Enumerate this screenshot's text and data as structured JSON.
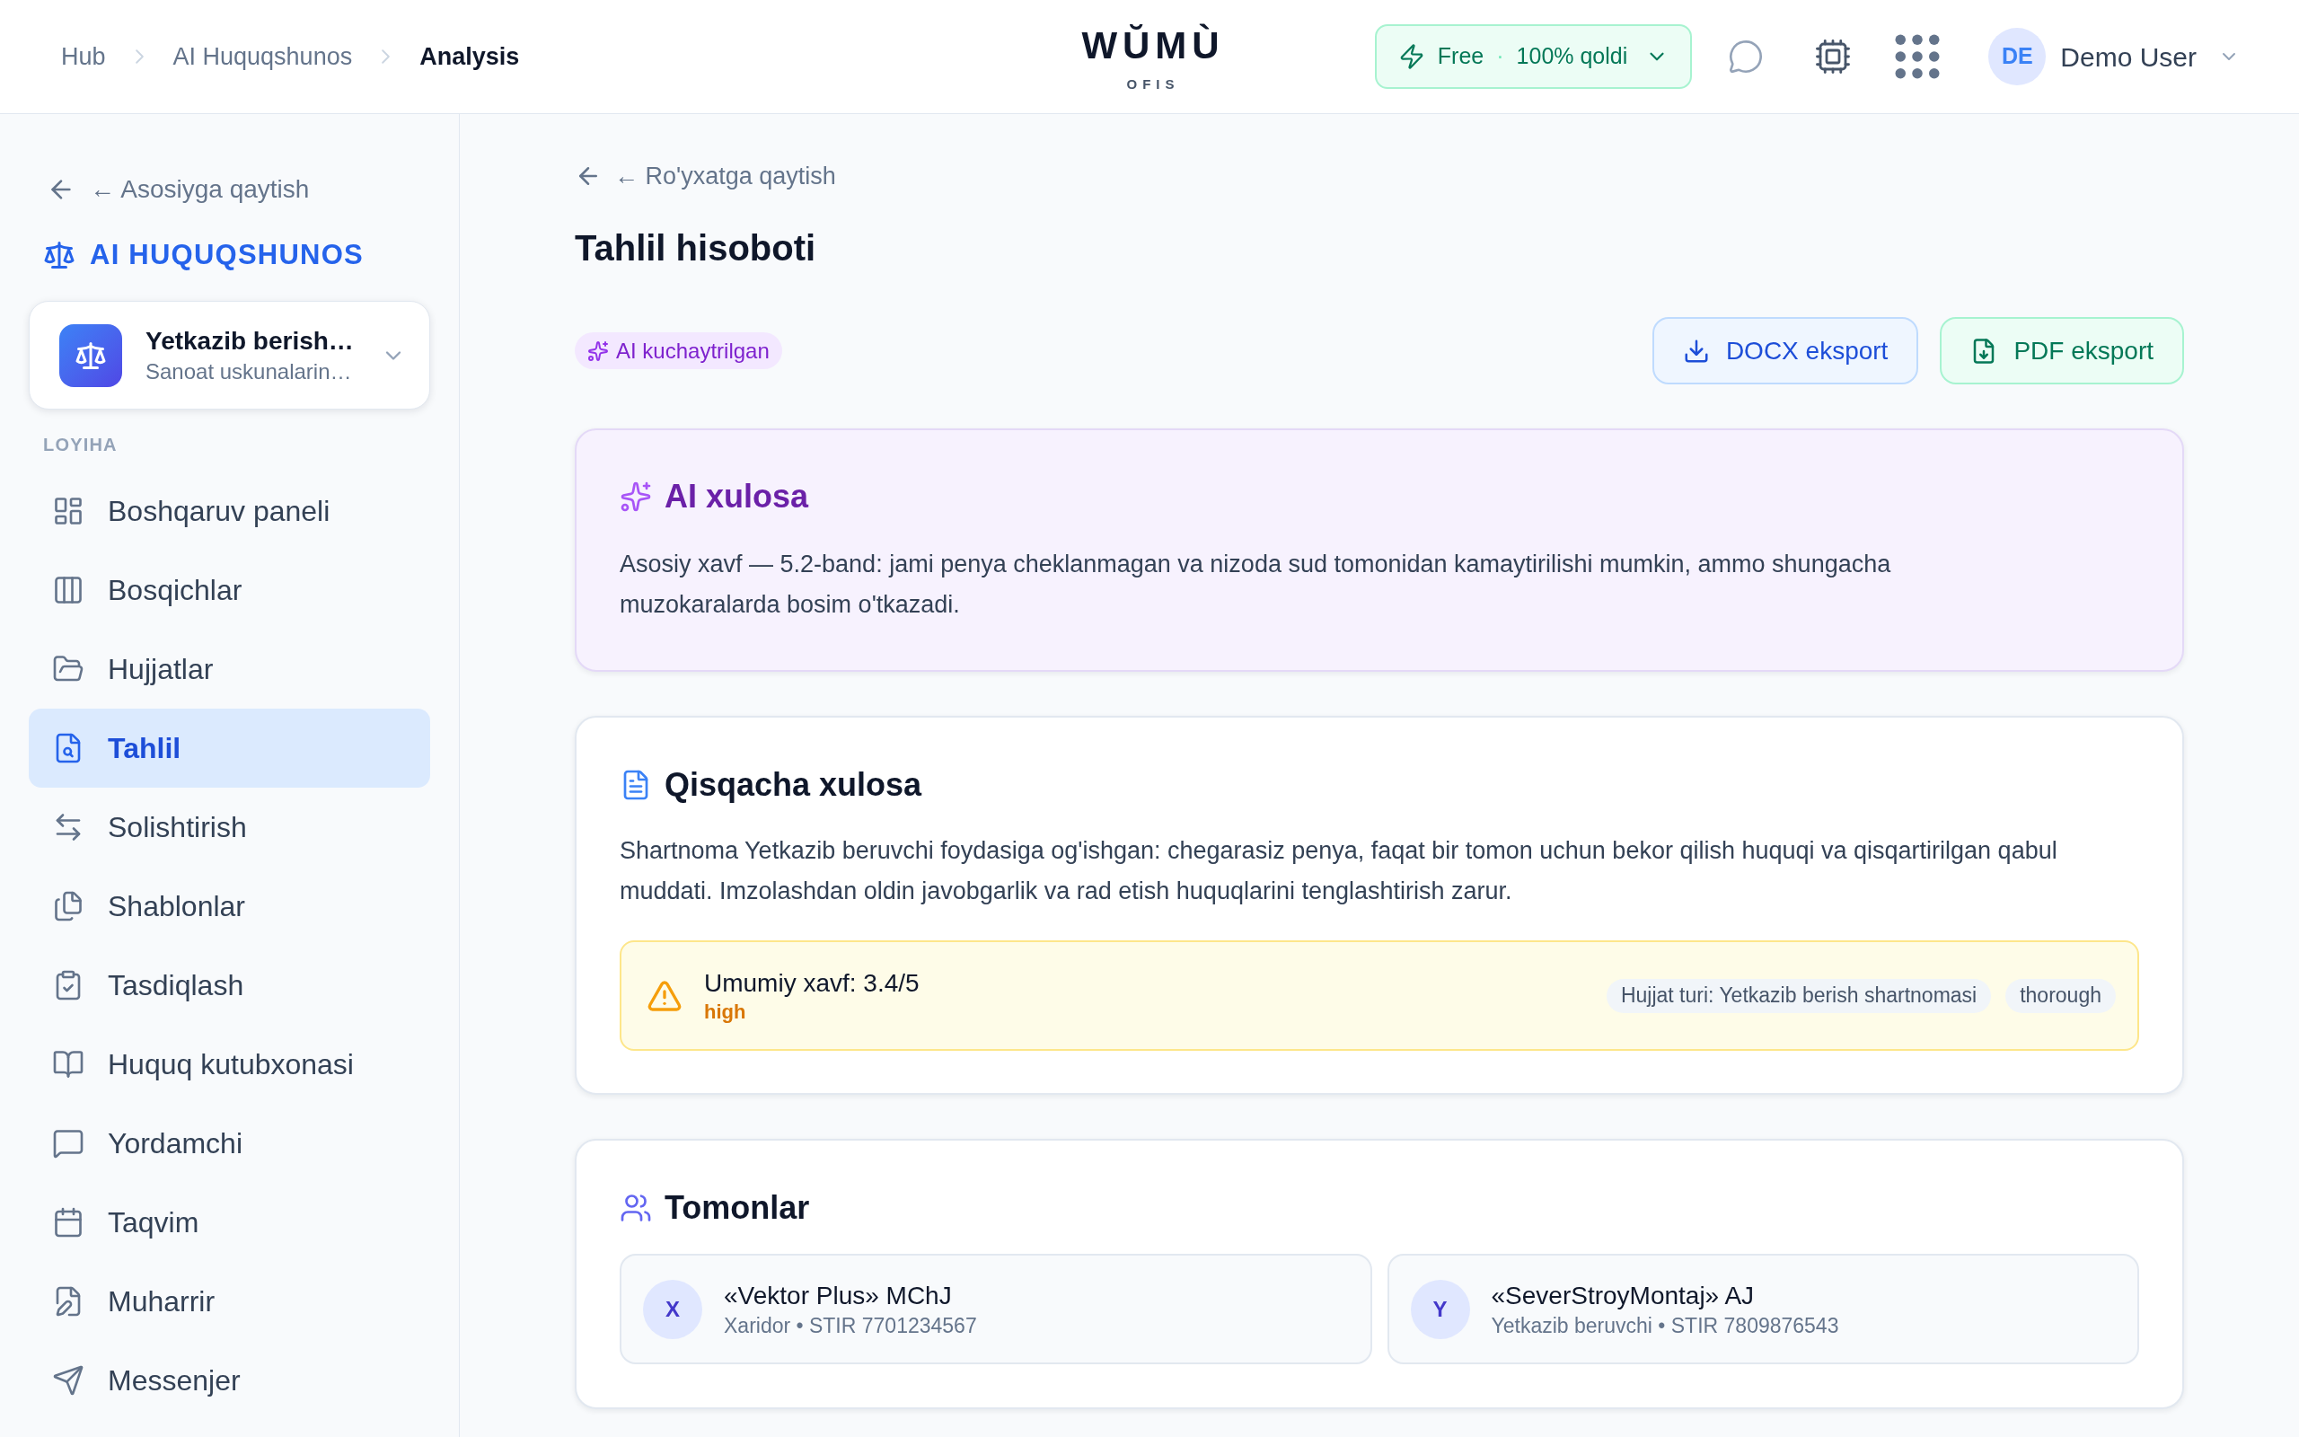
{
  "header": {
    "breadcrumbs": [
      {
        "label": "Hub",
        "current": false
      },
      {
        "label": "AI Huquqshunos",
        "current": false
      },
      {
        "label": "Analysis",
        "current": true
      }
    ],
    "logo": {
      "name": "WŬMÙ",
      "tagline": "OFIS"
    },
    "plan": {
      "name": "Free",
      "separator": "·",
      "quota": "100% qoldi"
    },
    "user": {
      "initials": "DE",
      "name": "Demo User"
    }
  },
  "sidebar": {
    "back_link": "← Asosiyga qaytish",
    "section_title": "AI HUQUQSHUNOS",
    "project": {
      "title": "Yetkazib berish…",
      "subtitle": "Sanoat uskunalarin…"
    },
    "group_label": "LOYIHA",
    "items": [
      {
        "label": "Boshqaruv paneli",
        "selected": false
      },
      {
        "label": "Bosqichlar",
        "selected": false
      },
      {
        "label": "Hujjatlar",
        "selected": false
      },
      {
        "label": "Tahlil",
        "selected": true
      },
      {
        "label": "Solishtirish",
        "selected": false
      },
      {
        "label": "Shablonlar",
        "selected": false
      },
      {
        "label": "Tasdiqlash",
        "selected": false
      },
      {
        "label": "Huquq kutubxonasi",
        "selected": false
      },
      {
        "label": "Yordamchi",
        "selected": false
      },
      {
        "label": "Taqvim",
        "selected": false
      },
      {
        "label": "Muharrir",
        "selected": false
      },
      {
        "label": "Messenjer",
        "selected": false
      }
    ]
  },
  "main": {
    "back_link": "← Ro'yxatga qaytish",
    "title": "Tahlil hisoboti",
    "badge": "AI kuchaytrilgan",
    "actions": [
      {
        "label": "DOCX eksport",
        "kind": "docx"
      },
      {
        "label": "PDF eksport",
        "kind": "pdf"
      }
    ],
    "ai_summary": {
      "title": "AI xulosa",
      "text": "Asosiy xavf — 5.2-band: jami penya cheklanmagan va nizoda sud tomonidan kamaytirilishi mumkin, ammo shungacha muzokaralarda bosim o'tkazadi."
    },
    "summary": {
      "title": "Qisqacha xulosa",
      "text": "Shartnoma Yetkazib beruvchi foydasiga og'ishgan: chegarasiz penya, faqat bir tomon uchun bekor qilish huquqi va qisqartirilgan qabul muddati. Imzolashdan oldin javobgarlik va rad etish huquqlarini tenglashtirish zarur.",
      "risk": {
        "score": "Umumiy xavf: 3.4/5",
        "level_label": "high",
        "tags": [
          "Hujjat turi: Yetkazib berish shartnomasi",
          "thorough"
        ]
      }
    },
    "parties": {
      "title": "Tomonlar",
      "items": [
        {
          "initial": "X",
          "name": "«Vektor Plus» MChJ",
          "details": "Xaridor • STIR 7701234567"
        },
        {
          "initial": "Y",
          "name": "«SeverStroyMontaj» AJ",
          "details": "Yetkazib beruvchi • STIR 7809876543"
        }
      ]
    }
  }
}
